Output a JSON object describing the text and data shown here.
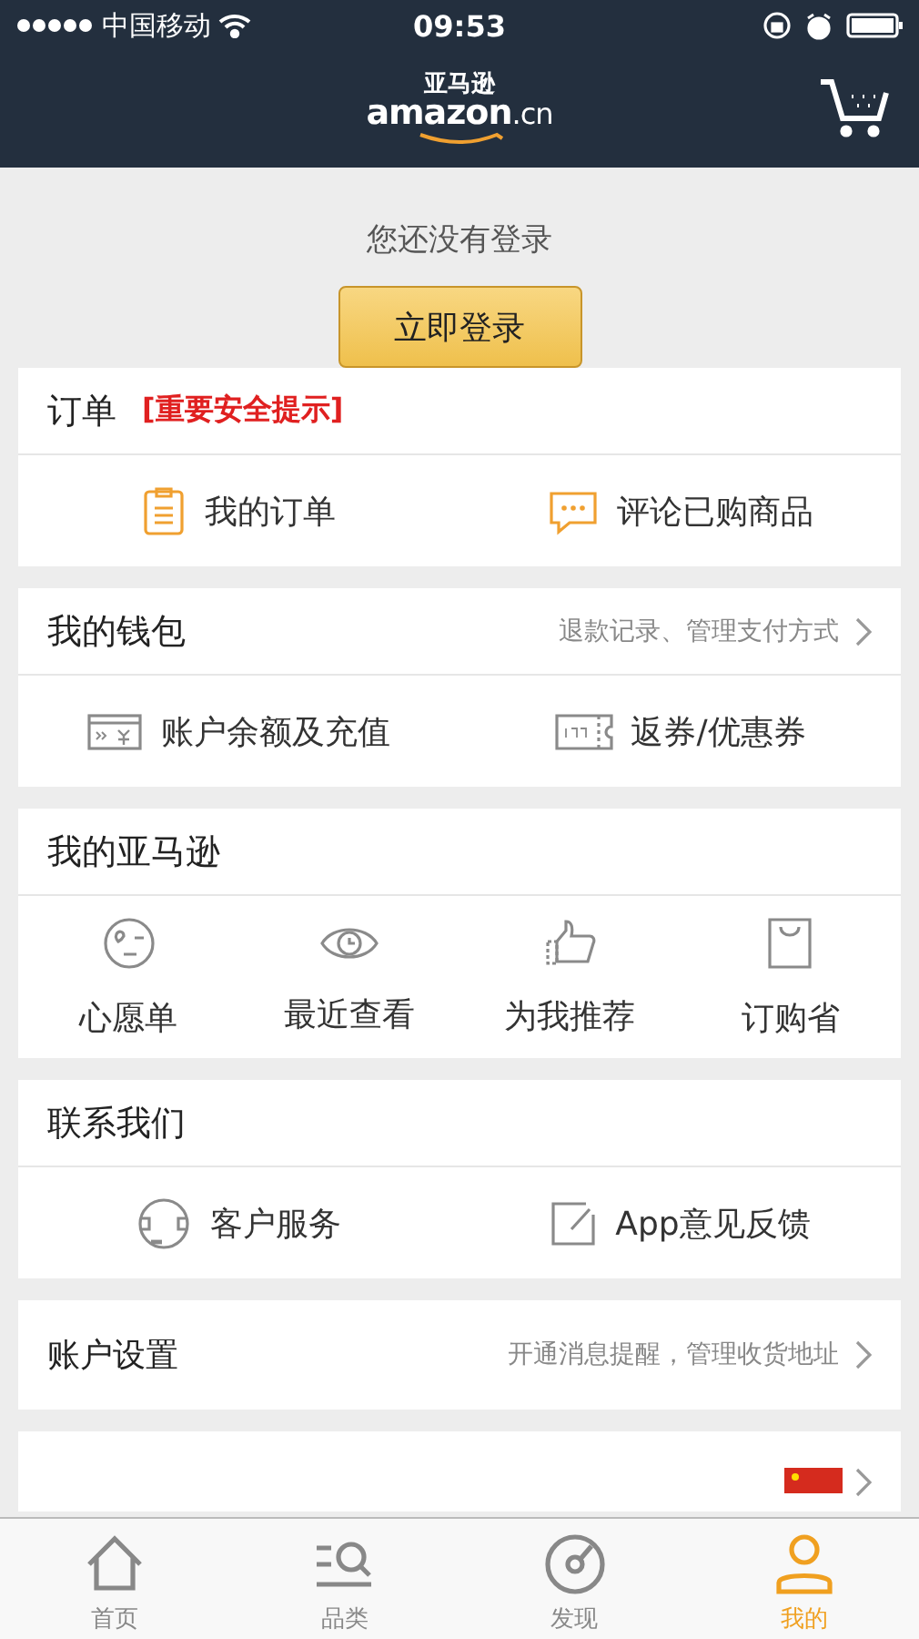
{
  "status_bar": {
    "carrier": "中国移动",
    "time": "09:53"
  },
  "header": {
    "logo_top": "亚马逊",
    "logo_main": "amazon",
    "logo_suffix": ".cn"
  },
  "login": {
    "prompt": "您还没有登录",
    "button": "立即登录"
  },
  "sections": [
    {
      "kind": "pair",
      "title": "订单",
      "notice": "[重要安全提示]",
      "items": [
        {
          "kind": "orders",
          "label": "我的订单"
        },
        {
          "kind": "review",
          "label": "评论已购商品"
        }
      ]
    },
    {
      "kind": "pair",
      "title": "我的钱包",
      "hint": "退款记录、管理支付方式",
      "items": [
        {
          "kind": "balance",
          "label": "账户余额及充值"
        },
        {
          "kind": "coupon",
          "label": "返券/优惠券"
        }
      ]
    },
    {
      "kind": "grid",
      "title": "我的亚马逊",
      "items": [
        {
          "kind": "wish",
          "label": "心愿单"
        },
        {
          "kind": "recent",
          "label": "最近查看"
        },
        {
          "kind": "recommend",
          "label": "为我推荐"
        },
        {
          "kind": "subscribe",
          "label": "订购省"
        }
      ]
    },
    {
      "kind": "pair",
      "title": "联系我们",
      "items": [
        {
          "kind": "service",
          "label": "客户服务"
        },
        {
          "kind": "feedback",
          "label": "App意见反馈"
        }
      ]
    },
    {
      "kind": "link",
      "title": "账户设置",
      "hint": "开通消息提醒，管理收货地址"
    },
    {
      "kind": "country"
    }
  ],
  "tabs": [
    {
      "kind": "home",
      "label": "首页",
      "selected": false
    },
    {
      "kind": "category",
      "label": "品类",
      "selected": false
    },
    {
      "kind": "discover",
      "label": "发现",
      "selected": false
    },
    {
      "kind": "me",
      "label": "我的",
      "selected": true
    }
  ]
}
